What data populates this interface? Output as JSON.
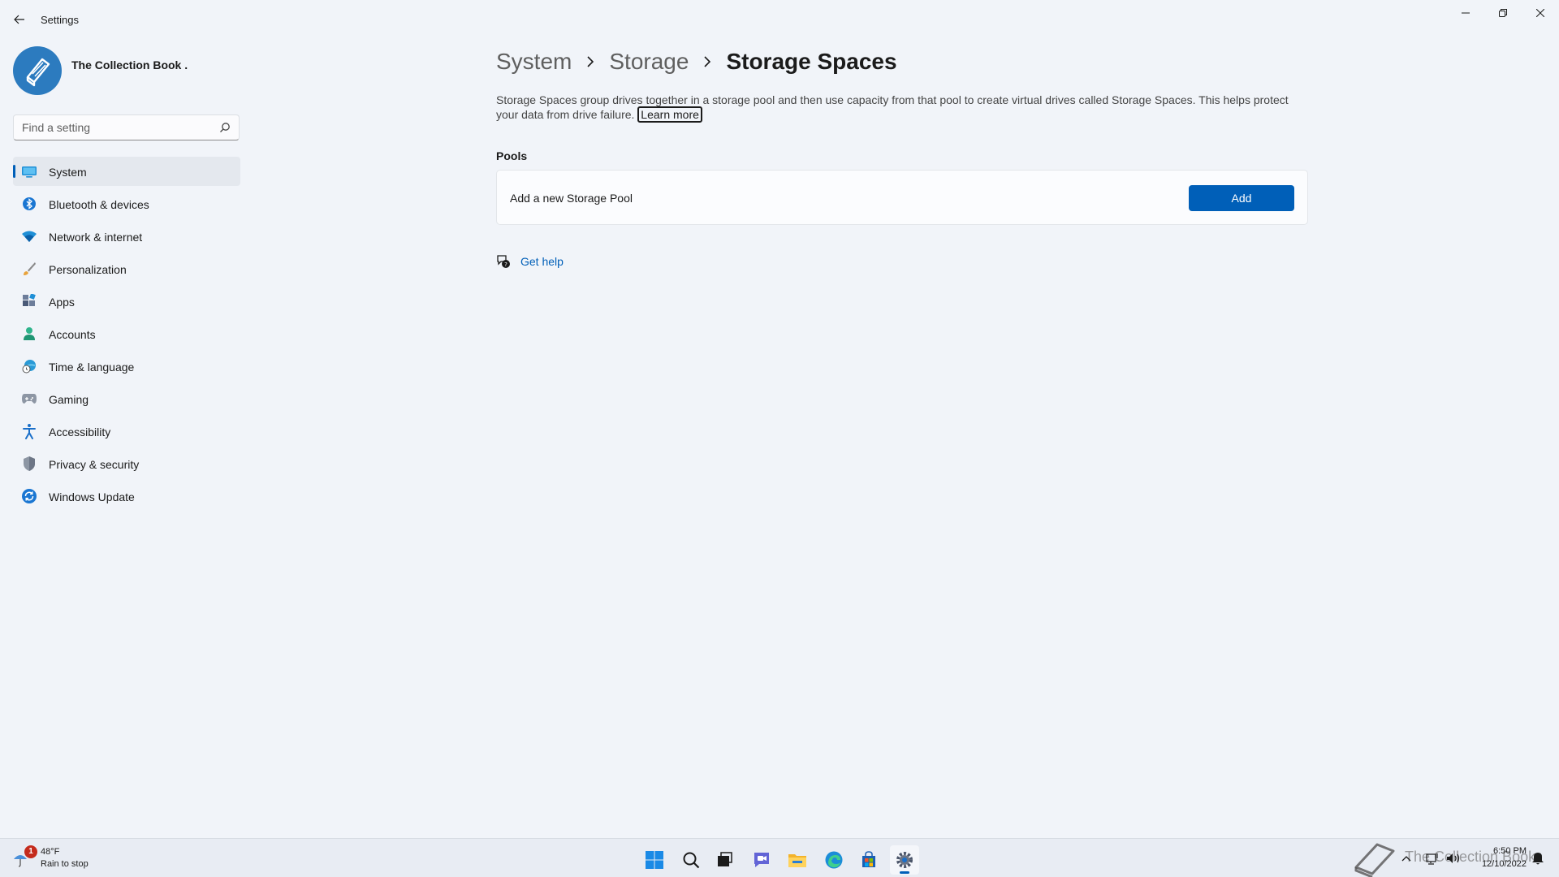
{
  "window": {
    "title": "Settings"
  },
  "profile": {
    "name": "The Collection Book ."
  },
  "search": {
    "placeholder": "Find a setting"
  },
  "sidebar": {
    "items": [
      {
        "label": "System",
        "icon": "system-icon",
        "active": true
      },
      {
        "label": "Bluetooth & devices",
        "icon": "bluetooth-icon"
      },
      {
        "label": "Network & internet",
        "icon": "wifi-icon"
      },
      {
        "label": "Personalization",
        "icon": "brush-icon"
      },
      {
        "label": "Apps",
        "icon": "apps-icon"
      },
      {
        "label": "Accounts",
        "icon": "account-icon"
      },
      {
        "label": "Time & language",
        "icon": "globe-clock-icon"
      },
      {
        "label": "Gaming",
        "icon": "gamepad-icon"
      },
      {
        "label": "Accessibility",
        "icon": "accessibility-icon"
      },
      {
        "label": "Privacy & security",
        "icon": "shield-icon"
      },
      {
        "label": "Windows Update",
        "icon": "update-icon"
      }
    ]
  },
  "breadcrumb": {
    "items": [
      "System",
      "Storage"
    ],
    "current": "Storage Spaces"
  },
  "main": {
    "description": "Storage Spaces group drives together in a storage pool and then use capacity from that pool to create virtual drives called Storage Spaces. This helps protect your data from drive failure.",
    "learn_more": "Learn more",
    "pools_title": "Pools",
    "pool_card_label": "Add a new Storage Pool",
    "add_button": "Add",
    "get_help": "Get help"
  },
  "taskbar": {
    "weather": {
      "badge": "1",
      "temp": "48°F",
      "desc": "Rain to stop"
    },
    "watermark": "The Collection Book",
    "clock": {
      "time": "6:50 PM",
      "date": "12/10/2022"
    }
  },
  "colors": {
    "accent": "#005fb8",
    "window_bg": "#f1f4f9",
    "card_bg": "#fbfcfe"
  }
}
